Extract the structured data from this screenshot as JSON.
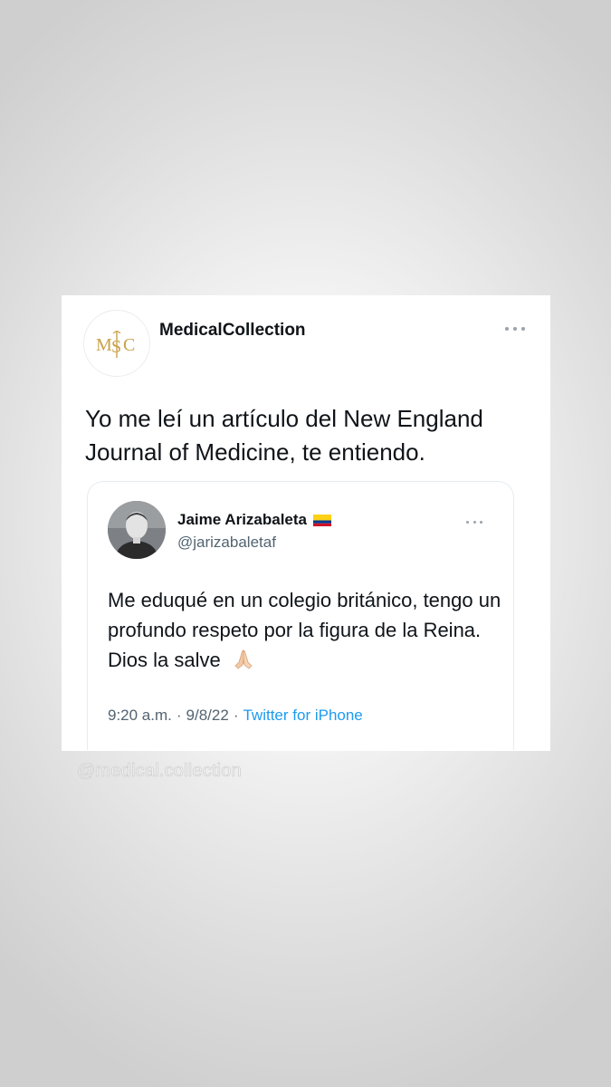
{
  "tweet": {
    "author_name": "MedicalCollection",
    "logo_text": "MSC",
    "text": "Yo me leí un artículo del New England Journal of Medicine, te entiendo."
  },
  "quoted_tweet": {
    "author_name": "Jaime Arizabaleta",
    "handle": "@jarizabaletaf",
    "text": "Me eduqué en un colegio británico, tengo un profundo respeto por la figura de la Reina. Dios la salve",
    "time": "9:20 a.m.",
    "date": "9/8/22",
    "source": "Twitter for iPhone",
    "separator": "·"
  },
  "watermark": {
    "text": "@medical.collection"
  },
  "colors": {
    "link_blue": "#1d9bf0",
    "text_dark": "#0f1419",
    "text_gray": "#536471",
    "logo_gold": "#c9a24a"
  },
  "icons": {
    "more": "more-options-icon",
    "flag": "colombia-flag-icon",
    "emoji": "praying-hands-icon"
  }
}
